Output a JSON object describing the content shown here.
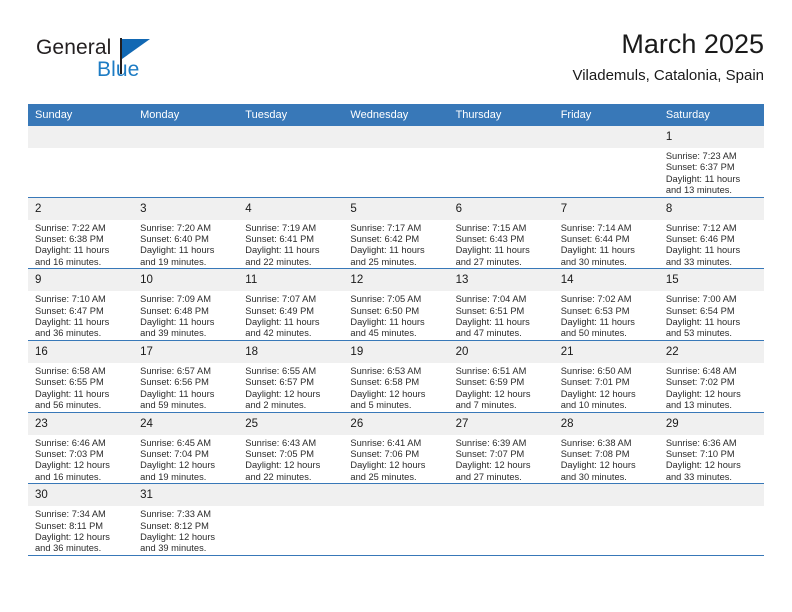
{
  "brand": {
    "name_part1": "General",
    "name_part2": "Blue",
    "flag_icon": "triangle-flag-icon"
  },
  "header": {
    "month_title": "March 2025",
    "location": "Vilademuls, Catalonia, Spain"
  },
  "colors": {
    "header_blue": "#3878b8",
    "brand_blue": "#1d7cc4",
    "daynum_bg": "#f0f0f0",
    "text": "#1a1a1a"
  },
  "weekdays": [
    "Sunday",
    "Monday",
    "Tuesday",
    "Wednesday",
    "Thursday",
    "Friday",
    "Saturday"
  ],
  "weeks": [
    [
      {
        "day": "",
        "empty": true
      },
      {
        "day": "",
        "empty": true
      },
      {
        "day": "",
        "empty": true
      },
      {
        "day": "",
        "empty": true
      },
      {
        "day": "",
        "empty": true
      },
      {
        "day": "",
        "empty": true
      },
      {
        "day": "1",
        "sunrise": "Sunrise: 7:23 AM",
        "sunset": "Sunset: 6:37 PM",
        "daylight1": "Daylight: 11 hours",
        "daylight2": "and 13 minutes."
      }
    ],
    [
      {
        "day": "2",
        "sunrise": "Sunrise: 7:22 AM",
        "sunset": "Sunset: 6:38 PM",
        "daylight1": "Daylight: 11 hours",
        "daylight2": "and 16 minutes."
      },
      {
        "day": "3",
        "sunrise": "Sunrise: 7:20 AM",
        "sunset": "Sunset: 6:40 PM",
        "daylight1": "Daylight: 11 hours",
        "daylight2": "and 19 minutes."
      },
      {
        "day": "4",
        "sunrise": "Sunrise: 7:19 AM",
        "sunset": "Sunset: 6:41 PM",
        "daylight1": "Daylight: 11 hours",
        "daylight2": "and 22 minutes."
      },
      {
        "day": "5",
        "sunrise": "Sunrise: 7:17 AM",
        "sunset": "Sunset: 6:42 PM",
        "daylight1": "Daylight: 11 hours",
        "daylight2": "and 25 minutes."
      },
      {
        "day": "6",
        "sunrise": "Sunrise: 7:15 AM",
        "sunset": "Sunset: 6:43 PM",
        "daylight1": "Daylight: 11 hours",
        "daylight2": "and 27 minutes."
      },
      {
        "day": "7",
        "sunrise": "Sunrise: 7:14 AM",
        "sunset": "Sunset: 6:44 PM",
        "daylight1": "Daylight: 11 hours",
        "daylight2": "and 30 minutes."
      },
      {
        "day": "8",
        "sunrise": "Sunrise: 7:12 AM",
        "sunset": "Sunset: 6:46 PM",
        "daylight1": "Daylight: 11 hours",
        "daylight2": "and 33 minutes."
      }
    ],
    [
      {
        "day": "9",
        "sunrise": "Sunrise: 7:10 AM",
        "sunset": "Sunset: 6:47 PM",
        "daylight1": "Daylight: 11 hours",
        "daylight2": "and 36 minutes."
      },
      {
        "day": "10",
        "sunrise": "Sunrise: 7:09 AM",
        "sunset": "Sunset: 6:48 PM",
        "daylight1": "Daylight: 11 hours",
        "daylight2": "and 39 minutes."
      },
      {
        "day": "11",
        "sunrise": "Sunrise: 7:07 AM",
        "sunset": "Sunset: 6:49 PM",
        "daylight1": "Daylight: 11 hours",
        "daylight2": "and 42 minutes."
      },
      {
        "day": "12",
        "sunrise": "Sunrise: 7:05 AM",
        "sunset": "Sunset: 6:50 PM",
        "daylight1": "Daylight: 11 hours",
        "daylight2": "and 45 minutes."
      },
      {
        "day": "13",
        "sunrise": "Sunrise: 7:04 AM",
        "sunset": "Sunset: 6:51 PM",
        "daylight1": "Daylight: 11 hours",
        "daylight2": "and 47 minutes."
      },
      {
        "day": "14",
        "sunrise": "Sunrise: 7:02 AM",
        "sunset": "Sunset: 6:53 PM",
        "daylight1": "Daylight: 11 hours",
        "daylight2": "and 50 minutes."
      },
      {
        "day": "15",
        "sunrise": "Sunrise: 7:00 AM",
        "sunset": "Sunset: 6:54 PM",
        "daylight1": "Daylight: 11 hours",
        "daylight2": "and 53 minutes."
      }
    ],
    [
      {
        "day": "16",
        "sunrise": "Sunrise: 6:58 AM",
        "sunset": "Sunset: 6:55 PM",
        "daylight1": "Daylight: 11 hours",
        "daylight2": "and 56 minutes."
      },
      {
        "day": "17",
        "sunrise": "Sunrise: 6:57 AM",
        "sunset": "Sunset: 6:56 PM",
        "daylight1": "Daylight: 11 hours",
        "daylight2": "and 59 minutes."
      },
      {
        "day": "18",
        "sunrise": "Sunrise: 6:55 AM",
        "sunset": "Sunset: 6:57 PM",
        "daylight1": "Daylight: 12 hours",
        "daylight2": "and 2 minutes."
      },
      {
        "day": "19",
        "sunrise": "Sunrise: 6:53 AM",
        "sunset": "Sunset: 6:58 PM",
        "daylight1": "Daylight: 12 hours",
        "daylight2": "and 5 minutes."
      },
      {
        "day": "20",
        "sunrise": "Sunrise: 6:51 AM",
        "sunset": "Sunset: 6:59 PM",
        "daylight1": "Daylight: 12 hours",
        "daylight2": "and 7 minutes."
      },
      {
        "day": "21",
        "sunrise": "Sunrise: 6:50 AM",
        "sunset": "Sunset: 7:01 PM",
        "daylight1": "Daylight: 12 hours",
        "daylight2": "and 10 minutes."
      },
      {
        "day": "22",
        "sunrise": "Sunrise: 6:48 AM",
        "sunset": "Sunset: 7:02 PM",
        "daylight1": "Daylight: 12 hours",
        "daylight2": "and 13 minutes."
      }
    ],
    [
      {
        "day": "23",
        "sunrise": "Sunrise: 6:46 AM",
        "sunset": "Sunset: 7:03 PM",
        "daylight1": "Daylight: 12 hours",
        "daylight2": "and 16 minutes."
      },
      {
        "day": "24",
        "sunrise": "Sunrise: 6:45 AM",
        "sunset": "Sunset: 7:04 PM",
        "daylight1": "Daylight: 12 hours",
        "daylight2": "and 19 minutes."
      },
      {
        "day": "25",
        "sunrise": "Sunrise: 6:43 AM",
        "sunset": "Sunset: 7:05 PM",
        "daylight1": "Daylight: 12 hours",
        "daylight2": "and 22 minutes."
      },
      {
        "day": "26",
        "sunrise": "Sunrise: 6:41 AM",
        "sunset": "Sunset: 7:06 PM",
        "daylight1": "Daylight: 12 hours",
        "daylight2": "and 25 minutes."
      },
      {
        "day": "27",
        "sunrise": "Sunrise: 6:39 AM",
        "sunset": "Sunset: 7:07 PM",
        "daylight1": "Daylight: 12 hours",
        "daylight2": "and 27 minutes."
      },
      {
        "day": "28",
        "sunrise": "Sunrise: 6:38 AM",
        "sunset": "Sunset: 7:08 PM",
        "daylight1": "Daylight: 12 hours",
        "daylight2": "and 30 minutes."
      },
      {
        "day": "29",
        "sunrise": "Sunrise: 6:36 AM",
        "sunset": "Sunset: 7:10 PM",
        "daylight1": "Daylight: 12 hours",
        "daylight2": "and 33 minutes."
      }
    ],
    [
      {
        "day": "30",
        "sunrise": "Sunrise: 7:34 AM",
        "sunset": "Sunset: 8:11 PM",
        "daylight1": "Daylight: 12 hours",
        "daylight2": "and 36 minutes."
      },
      {
        "day": "31",
        "sunrise": "Sunrise: 7:33 AM",
        "sunset": "Sunset: 8:12 PM",
        "daylight1": "Daylight: 12 hours",
        "daylight2": "and 39 minutes."
      },
      {
        "day": "",
        "empty": true
      },
      {
        "day": "",
        "empty": true
      },
      {
        "day": "",
        "empty": true
      },
      {
        "day": "",
        "empty": true
      },
      {
        "day": "",
        "empty": true
      }
    ]
  ]
}
